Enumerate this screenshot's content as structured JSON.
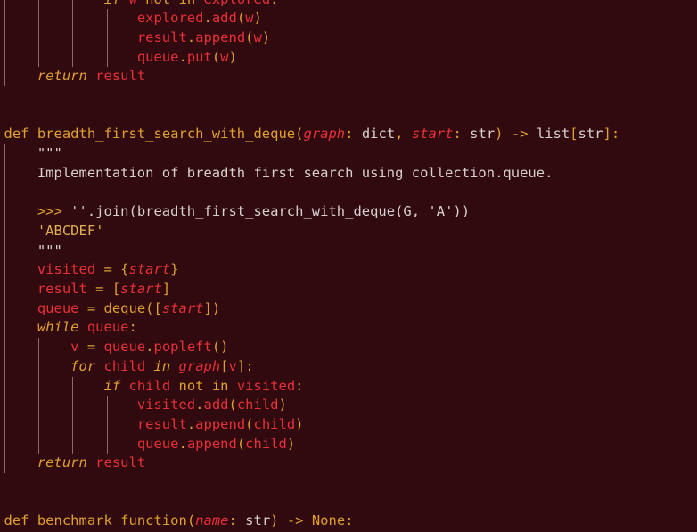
{
  "editor": {
    "colors": {
      "background": "#300a0e",
      "keyword": "#e0a030",
      "variable": "#e8303a",
      "text": "#d8d0d0",
      "indent_guide": "#8a6a6e"
    },
    "lines": [
      {
        "tokens": [
          {
            "t": "            "
          },
          {
            "t": "if",
            "c": "kwi"
          },
          {
            "t": " "
          },
          {
            "t": "w",
            "c": "var"
          },
          {
            "t": " not in ",
            "c": "kw"
          },
          {
            "t": "explored",
            "c": "var"
          },
          {
            "t": ":",
            "c": "op"
          }
        ]
      },
      {
        "tokens": [
          {
            "t": "                "
          },
          {
            "t": "explored",
            "c": "var"
          },
          {
            "t": ".",
            "c": "op"
          },
          {
            "t": "add",
            "c": "var"
          },
          {
            "t": "(",
            "c": "op"
          },
          {
            "t": "w",
            "c": "var"
          },
          {
            "t": ")",
            "c": "op"
          }
        ]
      },
      {
        "tokens": [
          {
            "t": "                "
          },
          {
            "t": "result",
            "c": "var"
          },
          {
            "t": ".",
            "c": "op"
          },
          {
            "t": "append",
            "c": "var"
          },
          {
            "t": "(",
            "c": "op"
          },
          {
            "t": "w",
            "c": "var"
          },
          {
            "t": ")",
            "c": "op"
          }
        ]
      },
      {
        "tokens": [
          {
            "t": "                "
          },
          {
            "t": "queue",
            "c": "var"
          },
          {
            "t": ".",
            "c": "op"
          },
          {
            "t": "put",
            "c": "var"
          },
          {
            "t": "(",
            "c": "op"
          },
          {
            "t": "w",
            "c": "var"
          },
          {
            "t": ")",
            "c": "op"
          }
        ]
      },
      {
        "tokens": [
          {
            "t": "    "
          },
          {
            "t": "return",
            "c": "kwi"
          },
          {
            "t": " "
          },
          {
            "t": "result",
            "c": "var"
          }
        ]
      },
      {
        "tokens": []
      },
      {
        "tokens": []
      },
      {
        "tokens": [
          {
            "t": "def",
            "c": "kw"
          },
          {
            "t": " "
          },
          {
            "t": "breadth_first_search_with_deque",
            "c": "fn"
          },
          {
            "t": "(",
            "c": "op"
          },
          {
            "t": "graph",
            "c": "param"
          },
          {
            "t": ": ",
            "c": "op"
          },
          {
            "t": "dict",
            "c": "type"
          },
          {
            "t": ", ",
            "c": "op"
          },
          {
            "t": "start",
            "c": "param"
          },
          {
            "t": ": ",
            "c": "op"
          },
          {
            "t": "str",
            "c": "type"
          },
          {
            "t": ") -> ",
            "c": "op"
          },
          {
            "t": "list",
            "c": "type"
          },
          {
            "t": "[",
            "c": "op"
          },
          {
            "t": "str",
            "c": "type"
          },
          {
            "t": "]:",
            "c": "op"
          }
        ]
      },
      {
        "tokens": [
          {
            "t": "    "
          },
          {
            "t": "\"\"\"",
            "c": "doc"
          }
        ]
      },
      {
        "tokens": [
          {
            "t": "    "
          },
          {
            "t": "Implementation of breadth first search using collection.queue.",
            "c": "doc"
          }
        ]
      },
      {
        "tokens": []
      },
      {
        "tokens": [
          {
            "t": "    "
          },
          {
            "t": ">>>",
            "c": "prompt"
          },
          {
            "t": " ''.join(breadth_first_search_with_deque(G, 'A'))",
            "c": "doc"
          }
        ]
      },
      {
        "tokens": [
          {
            "t": "    "
          },
          {
            "t": "'ABCDEF'",
            "c": "str"
          }
        ]
      },
      {
        "tokens": [
          {
            "t": "    "
          },
          {
            "t": "\"\"\"",
            "c": "doc"
          }
        ]
      },
      {
        "tokens": [
          {
            "t": "    "
          },
          {
            "t": "visited",
            "c": "var"
          },
          {
            "t": " = {",
            "c": "op"
          },
          {
            "t": "start",
            "c": "param"
          },
          {
            "t": "}",
            "c": "op"
          }
        ]
      },
      {
        "tokens": [
          {
            "t": "    "
          },
          {
            "t": "result",
            "c": "var"
          },
          {
            "t": " = [",
            "c": "op"
          },
          {
            "t": "start",
            "c": "param"
          },
          {
            "t": "]",
            "c": "op"
          }
        ]
      },
      {
        "tokens": [
          {
            "t": "    "
          },
          {
            "t": "queue",
            "c": "var"
          },
          {
            "t": " = ",
            "c": "op"
          },
          {
            "t": "deque",
            "c": "fn"
          },
          {
            "t": "([",
            "c": "op"
          },
          {
            "t": "start",
            "c": "param"
          },
          {
            "t": "])",
            "c": "op"
          }
        ]
      },
      {
        "tokens": [
          {
            "t": "    "
          },
          {
            "t": "while",
            "c": "kwi"
          },
          {
            "t": " "
          },
          {
            "t": "queue",
            "c": "var"
          },
          {
            "t": ":",
            "c": "op"
          }
        ]
      },
      {
        "tokens": [
          {
            "t": "        "
          },
          {
            "t": "v",
            "c": "var"
          },
          {
            "t": " = ",
            "c": "op"
          },
          {
            "t": "queue",
            "c": "var"
          },
          {
            "t": ".",
            "c": "op"
          },
          {
            "t": "popleft",
            "c": "var"
          },
          {
            "t": "()",
            "c": "op"
          }
        ]
      },
      {
        "tokens": [
          {
            "t": "        "
          },
          {
            "t": "for",
            "c": "kwi"
          },
          {
            "t": " "
          },
          {
            "t": "child",
            "c": "var"
          },
          {
            "t": " "
          },
          {
            "t": "in",
            "c": "kwi"
          },
          {
            "t": " "
          },
          {
            "t": "graph",
            "c": "param"
          },
          {
            "t": "[",
            "c": "op"
          },
          {
            "t": "v",
            "c": "var"
          },
          {
            "t": "]:",
            "c": "op"
          }
        ]
      },
      {
        "tokens": [
          {
            "t": "            "
          },
          {
            "t": "if",
            "c": "kwi"
          },
          {
            "t": " "
          },
          {
            "t": "child",
            "c": "var"
          },
          {
            "t": " not in ",
            "c": "kw"
          },
          {
            "t": "visited",
            "c": "var"
          },
          {
            "t": ":",
            "c": "op"
          }
        ]
      },
      {
        "tokens": [
          {
            "t": "                "
          },
          {
            "t": "visited",
            "c": "var"
          },
          {
            "t": ".",
            "c": "op"
          },
          {
            "t": "add",
            "c": "var"
          },
          {
            "t": "(",
            "c": "op"
          },
          {
            "t": "child",
            "c": "var"
          },
          {
            "t": ")",
            "c": "op"
          }
        ]
      },
      {
        "tokens": [
          {
            "t": "                "
          },
          {
            "t": "result",
            "c": "var"
          },
          {
            "t": ".",
            "c": "op"
          },
          {
            "t": "append",
            "c": "var"
          },
          {
            "t": "(",
            "c": "op"
          },
          {
            "t": "child",
            "c": "var"
          },
          {
            "t": ")",
            "c": "op"
          }
        ]
      },
      {
        "tokens": [
          {
            "t": "                "
          },
          {
            "t": "queue",
            "c": "var"
          },
          {
            "t": ".",
            "c": "op"
          },
          {
            "t": "append",
            "c": "var"
          },
          {
            "t": "(",
            "c": "op"
          },
          {
            "t": "child",
            "c": "var"
          },
          {
            "t": ")",
            "c": "op"
          }
        ]
      },
      {
        "tokens": [
          {
            "t": "    "
          },
          {
            "t": "return",
            "c": "kwi"
          },
          {
            "t": " "
          },
          {
            "t": "result",
            "c": "var"
          }
        ]
      },
      {
        "tokens": []
      },
      {
        "tokens": []
      },
      {
        "tokens": [
          {
            "t": "def",
            "c": "kw"
          },
          {
            "t": " "
          },
          {
            "t": "benchmark_function",
            "c": "fn"
          },
          {
            "t": "(",
            "c": "op"
          },
          {
            "t": "name",
            "c": "param"
          },
          {
            "t": ": ",
            "c": "op"
          },
          {
            "t": "str",
            "c": "type"
          },
          {
            "t": ") -> ",
            "c": "op"
          },
          {
            "t": "None",
            "c": "const"
          },
          {
            "t": ":",
            "c": "op"
          }
        ]
      }
    ]
  }
}
